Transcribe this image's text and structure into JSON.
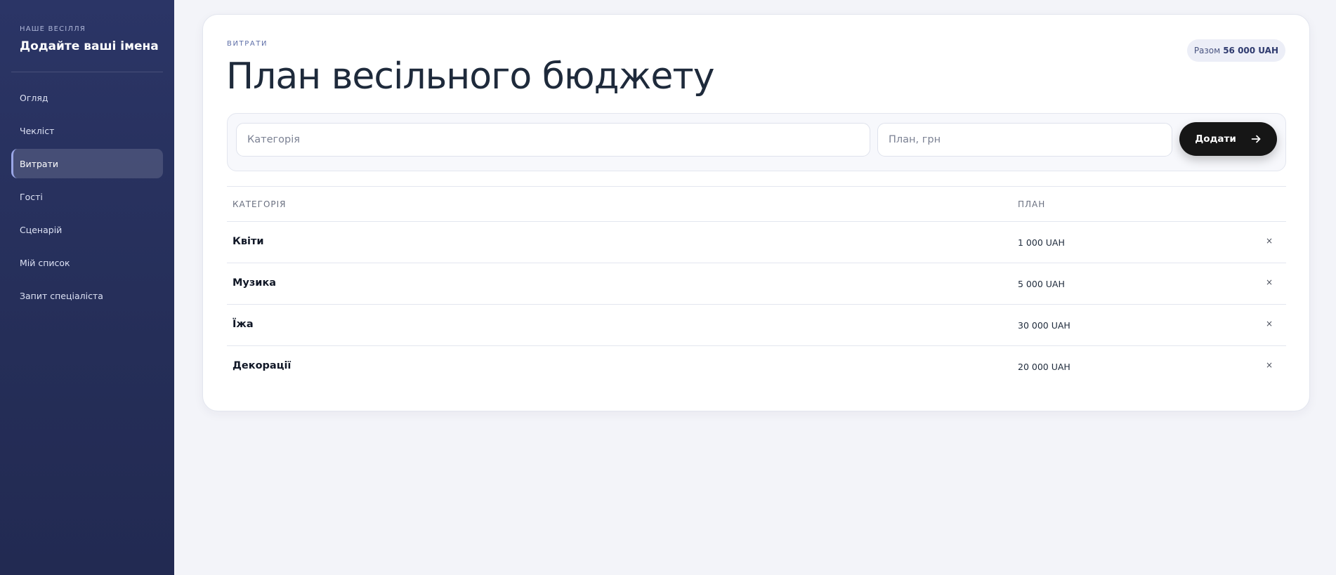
{
  "sidebar": {
    "eyebrow": "НАШЕ ВЕСІЛЛЯ",
    "title": "Додайте ваші імена",
    "items": [
      {
        "label": "Огляд"
      },
      {
        "label": "Чекліст"
      },
      {
        "label": "Витрати"
      },
      {
        "label": "Гості"
      },
      {
        "label": "Сценарій"
      },
      {
        "label": "Мій список"
      },
      {
        "label": "Запит спеціаліста"
      }
    ],
    "active_item": "Витрати"
  },
  "main": {
    "eyebrow": "ВИТРАТИ",
    "title": "План весільного бюджету",
    "total": {
      "label": "Разом",
      "value": "56 000 UAH"
    },
    "form": {
      "category_placeholder": "Категорія",
      "plan_placeholder": "План, грн",
      "add_label": "Додати",
      "add_icon": "arrow-right-icon"
    },
    "table": {
      "headers": {
        "category": "КАТЕГОРІЯ",
        "plan": "ПЛАН"
      },
      "rows": [
        {
          "category": "Квіти",
          "plan": "1 000 UAH",
          "delete": "×"
        },
        {
          "category": "Музика",
          "plan": "5 000 UAH",
          "delete": "×"
        },
        {
          "category": "Їжа",
          "plan": "30 000 UAH",
          "delete": "×"
        },
        {
          "category": "Декорації",
          "plan": "20 000 UAH",
          "delete": "×"
        }
      ]
    }
  },
  "colors": {
    "sidebar_bg": "#2b3566",
    "accent": "#5f6fa8",
    "button_bg": "#161616",
    "page_bg": "#f3f4f9"
  }
}
